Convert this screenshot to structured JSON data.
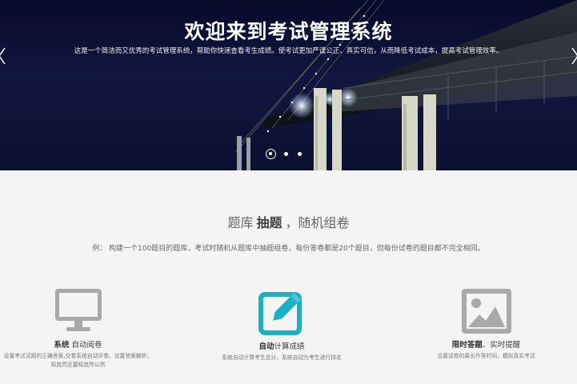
{
  "hero": {
    "title": "欢迎来到考试管理系统",
    "subtitle": "这是一个简洁而又优秀的考试管理系统，帮助你快速查看考生成绩。使考试更加严谨公正、真实可信，从而降低考试成本，提高考试管理效率。",
    "slides": 3,
    "active_slide": 1
  },
  "section": {
    "title_prefix": "题库",
    "title_bold": "抽题",
    "title_suffix": "，随机组卷",
    "description": "例： 构建一个100题目的题库，考试时随机从题库中抽题组卷，每份答卷都是20个题目，但每份试卷的题目都不完全相同。"
  },
  "features": [
    {
      "icon": "monitor-icon",
      "title_bold": "系统",
      "title_rest": "自动阅卷",
      "desc_line1": "设置考试试题的正确答案,交卷系统自动评卷。设置答案解析，",
      "desc_line2": "知其然还要知其所以然",
      "color": "#aaaaaa"
    },
    {
      "icon": "edit-icon",
      "title_bold": "自动",
      "title_rest": "计算成绩",
      "desc_line1": "系统自动计算考生总分，系统自动为考生进行排名",
      "desc_line2": "",
      "color": "#1ab0c6"
    },
    {
      "icon": "picture-icon",
      "title_bold": "限时答题",
      "title_rest": "、实时提醒",
      "desc_line1": "设置试卷的最长作答时间，模拟真实考试",
      "desc_line2": "",
      "color": "#aaaaaa"
    }
  ]
}
